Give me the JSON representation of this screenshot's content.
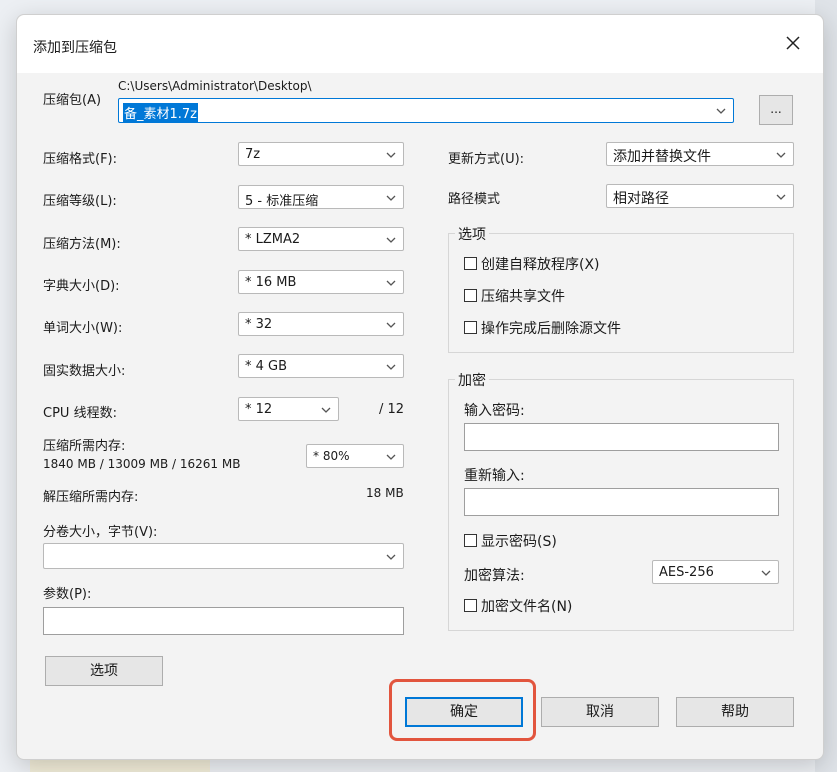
{
  "dialog": {
    "title": "添加到压缩包",
    "close_icon": "close-icon"
  },
  "archive": {
    "label": "压缩包(A)",
    "path": "C:\\Users\\Administrator\\Desktop\\",
    "name": "备_素材1.7z",
    "browse_label": "..."
  },
  "left": {
    "format": {
      "label": "压缩格式(F):",
      "value": "7z"
    },
    "level": {
      "label": "压缩等级(L):",
      "value": "5 - 标准压缩"
    },
    "method": {
      "label": "压缩方法(M):",
      "value": "* LZMA2"
    },
    "dict": {
      "label": "字典大小(D):",
      "value": "* 16 MB"
    },
    "word": {
      "label": "单词大小(W):",
      "value": "* 32"
    },
    "solid": {
      "label": "固实数据大小:",
      "value": "* 4 GB"
    },
    "cpu": {
      "label": "CPU 线程数:",
      "value": "* 12",
      "max": "/ 12"
    },
    "memory": {
      "label": "压缩所需内存:",
      "detail": "1840 MB / 13009 MB / 16261 MB",
      "value": "* 80%"
    },
    "decompress": {
      "label": "解压缩所需内存:",
      "value": "18 MB"
    },
    "volume": {
      "label": "分卷大小，字节(V):",
      "value": ""
    },
    "params": {
      "label": "参数(P):",
      "value": ""
    },
    "options_button": "选项"
  },
  "right": {
    "update": {
      "label": "更新方式(U):",
      "value": "添加并替换文件"
    },
    "path_mode": {
      "label": "路径模式",
      "value": "相对路径"
    },
    "options": {
      "title": "选项",
      "sfx": "创建自释放程序(X)",
      "shared": "压缩共享文件",
      "delete": "操作完成后删除源文件"
    },
    "encryption": {
      "title": "加密",
      "password_label": "输入密码:",
      "reenter_label": "重新输入:",
      "show_password": "显示密码(S)",
      "method_label": "加密算法:",
      "method_value": "AES-256",
      "encrypt_names": "加密文件名(N)"
    }
  },
  "buttons": {
    "ok": "确定",
    "cancel": "取消",
    "help": "帮助"
  },
  "colors": {
    "highlight": "#e2553e",
    "selection": "#0078d7"
  }
}
